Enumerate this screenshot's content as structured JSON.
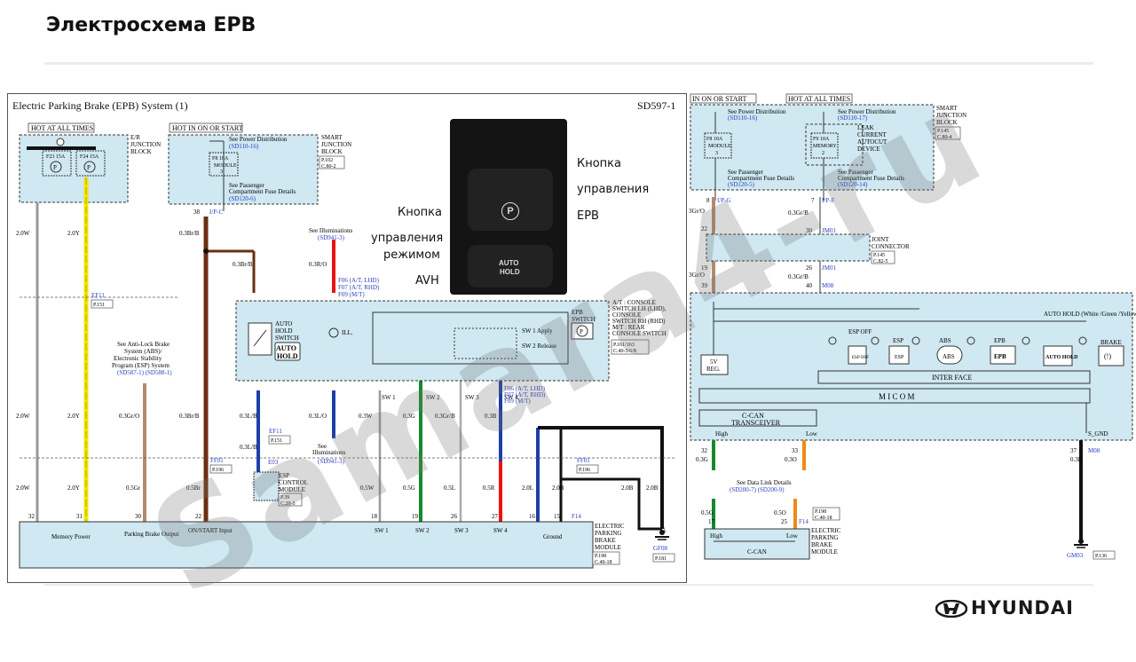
{
  "slide": {
    "title": "Электросхема EPB",
    "diagram_title": "Electric Parking Brake (EPB) System (1)",
    "sheet_code": "SD597-1",
    "watermark": "Samara4-ru",
    "brand": "HYUNDAI"
  },
  "photo_captions": {
    "epb_button": [
      "Кнопка",
      "управления",
      "EPB"
    ],
    "avh_button": [
      "Кнопка",
      "управления",
      "режимом",
      "AVH"
    ],
    "photo_top_symbol": "P",
    "photo_bottom_label_1": "AUTO",
    "photo_bottom_label_2": "HOLD"
  },
  "left": {
    "hot_all": "HOT AT ALL TIMES",
    "hot_on": "HOT IN ON OR START",
    "fuse1": "F23 15A",
    "fuse2": "F24 15A",
    "er_block": [
      "E/R",
      "JUNCTION",
      "BLOCK"
    ],
    "smart_block": [
      "SMART",
      "JUNCTION",
      "BLOCK"
    ],
    "smart_ref": [
      "P.102",
      "C.80-2"
    ],
    "see_power": "See Power Distribution",
    "see_power_ref": "(SD110-16)",
    "module_fuse": [
      "F8 10A",
      "MODULE",
      "3"
    ],
    "see_pass": "See Passenger",
    "see_pass2": "Compartment Fuse Details",
    "see_pass_ref": "(SD120-6)",
    "conn_ip": "I/P-C",
    "pin38": "38",
    "see_illum": "See Illuminations",
    "see_illum_ref": "(SD941-3)",
    "wire_03rO": "0.3R/O",
    "f06": "F06 (A/T, LHD)",
    "f07": "F07 (A/T, RHD)",
    "f09": "F09 (M/T)",
    "f06b": "F06 (A/T, LHD)",
    "f07b": "F07 (A/T, RHD)",
    "f09b": "F09 (M/T)",
    "console_text": [
      "A/T : CONSOLE",
      "SWITCH LH (LHD),",
      "CONSOLE",
      "SWITCH RH (RHD)",
      "M/T : REAR",
      "CONSOLE SWITCH"
    ],
    "console_ref": [
      "P.161/163",
      "C.40-5/6/8"
    ],
    "epb_switch": [
      "EPB",
      "SWITCH"
    ],
    "sw1_apply": "SW 1 Apply",
    "sw2_release": "SW 2 Release",
    "sw_labels": [
      "SW 1",
      "SW 2",
      "SW 3",
      "SW 4"
    ],
    "auto_hold_switch": [
      "AUTO",
      "HOLD",
      "SWITCH"
    ],
    "auto_hold_badge": [
      "AUTO",
      "HOLD"
    ],
    "ill": "ILL.",
    "abs_note": [
      "See Anti-Lock Brake",
      "System (ABS)/",
      "Electronic Stability",
      "Program (ESP) System"
    ],
    "abs_ref": "(SD587-1)  (SD588-1)",
    "ef11": "EF11",
    "ef11_p": "P.151",
    "ef11b": "EF11",
    "ef11b_p": "P.151",
    "ff01": "FF01",
    "ff01_p": "P.196",
    "ff01b": "FF01",
    "ff01b_p": "P.196",
    "e03": "E03",
    "esp_module": [
      "ESP",
      "CONTROL",
      "MODULE"
    ],
    "esp_ref": [
      "P.39",
      "C.20-5"
    ],
    "wires_top": [
      "2.0W",
      "2.0Y",
      "0.3Br/B",
      "0.3Br/B"
    ],
    "wires_mid": [
      "2.0W",
      "2.0Y",
      "0.3Gr/O",
      "0.3Br/B",
      "0.3L/B",
      "0.3L/O",
      "0.3W",
      "0.3G",
      "0.3Gr/B",
      "0.3B"
    ],
    "wires_low": [
      "2.0W",
      "2.0Y",
      "0.5Gr",
      "0.5Br",
      "0.5W",
      "0.5G",
      "0.5L",
      "0.5R",
      "2.0L",
      "2.0B",
      "2.0B",
      "2.0B"
    ],
    "pins_epbm": [
      "32",
      "31",
      "30",
      "22",
      "18",
      "19",
      "26",
      "27",
      "16",
      "15"
    ],
    "epbm_labels": [
      "Memory Power",
      "Parking Brake Output",
      "ON/START Input",
      "SW 1",
      "SW 2",
      "SW 3",
      "SW 4",
      "Ground"
    ],
    "epbm_name": [
      "ELECTRIC",
      "PARKING",
      "BRAKE",
      "MODULE"
    ],
    "epbm_ref": [
      "P.198",
      "C.40-18"
    ],
    "f14": "F14",
    "gf08": "GF08",
    "gf08_p": "P.181",
    "see_illum2": [
      "See",
      "Illuminations",
      "(SD941-3)"
    ]
  },
  "right": {
    "hot_on": "IN ON OR START",
    "hot_all": "HOT AT ALL TIMES",
    "see_power": "See Power Distribution",
    "see_power_ref1": "(SD110-16)",
    "see_power_ref2": "(SD110-17)",
    "fuse_module": [
      "F8 10A",
      "MODULE",
      "3"
    ],
    "fuse_memory": [
      "F9 10A",
      "MEMORY",
      "2"
    ],
    "leak_text": [
      "LEAK",
      "CURRENT",
      "AUTOCUT",
      "DEVICE"
    ],
    "smart_block": [
      "SMART",
      "JUNCTION",
      "BLOCK"
    ],
    "smart_ref": [
      "P.145",
      "C.80-4"
    ],
    "see_pass": "See Passenger",
    "see_pass2": "Compartment Fuse Details",
    "see_pass_ref1": "(SD120-5)",
    "see_pass_ref2": "(SD120-14)",
    "ip_g": "I/P-G",
    "ip_f": "I/P-F",
    "jm01": "JM01",
    "jm01b": "JM01",
    "m08": "M08",
    "joint_conn": [
      "JOINT",
      "CONNECTOR"
    ],
    "joint_ref": [
      "P.145",
      "C.82-5"
    ],
    "wires": [
      "3Gr/O",
      "0.3Gr/B",
      "3Gr/O",
      "0.3Gr/B",
      "3Gr/O",
      "0.3Gr/B"
    ],
    "pins_top": [
      "8",
      "7",
      "22",
      "30",
      "19",
      "26",
      "39",
      "40"
    ],
    "reg": [
      "5V",
      "REG."
    ],
    "indicators": [
      "ESP OFF",
      "ESP",
      "ABS",
      "EPB",
      "AUTO HOLD (White /Green /Yellow)",
      "BRAKE"
    ],
    "ind_icons": [
      "ESP OFF",
      "ESP",
      "ABS",
      "EPB",
      "AUTO HOLD",
      "(!)"
    ],
    "interface": "INTER FACE",
    "micom": "M I C O M",
    "ccan_tr": [
      "C-CAN",
      "TRANSCEIVER"
    ],
    "high": "High",
    "low": "Low",
    "s_gnd": "S_GND",
    "pins_bottom": [
      "32",
      "33",
      "37"
    ],
    "wires_bottom": [
      "0.3G",
      "0.3O",
      "0.3B"
    ],
    "m08b": "M08",
    "see_data_link": "See Data Link Details",
    "see_data_ref": "(SD200-7)  (SD200-9)",
    "pins_epbm": [
      "17",
      "25"
    ],
    "wires_epbm": [
      "0.5G",
      "0.5O"
    ],
    "f14": "F14",
    "epbm_ref": [
      "P.198",
      "C.40-18"
    ],
    "ccan": "C-CAN",
    "epbm_name": [
      "ELECTRIC",
      "PARKING",
      "BRAKE",
      "MODULE"
    ],
    "gm03": "GM03",
    "gm03_p": "P.136"
  },
  "colors": {
    "block_fill": "#cfe8f1",
    "wire_yellow": "#f2e600",
    "wire_brown": "#6b2e10",
    "wire_red": "#ee1111",
    "wire_blue": "#1d3fa8",
    "wire_green": "#148a2e",
    "wire_grbrown": "#b38b6d",
    "wire_orange": "#f08a18",
    "ref_blue": "#2a3fc4"
  }
}
